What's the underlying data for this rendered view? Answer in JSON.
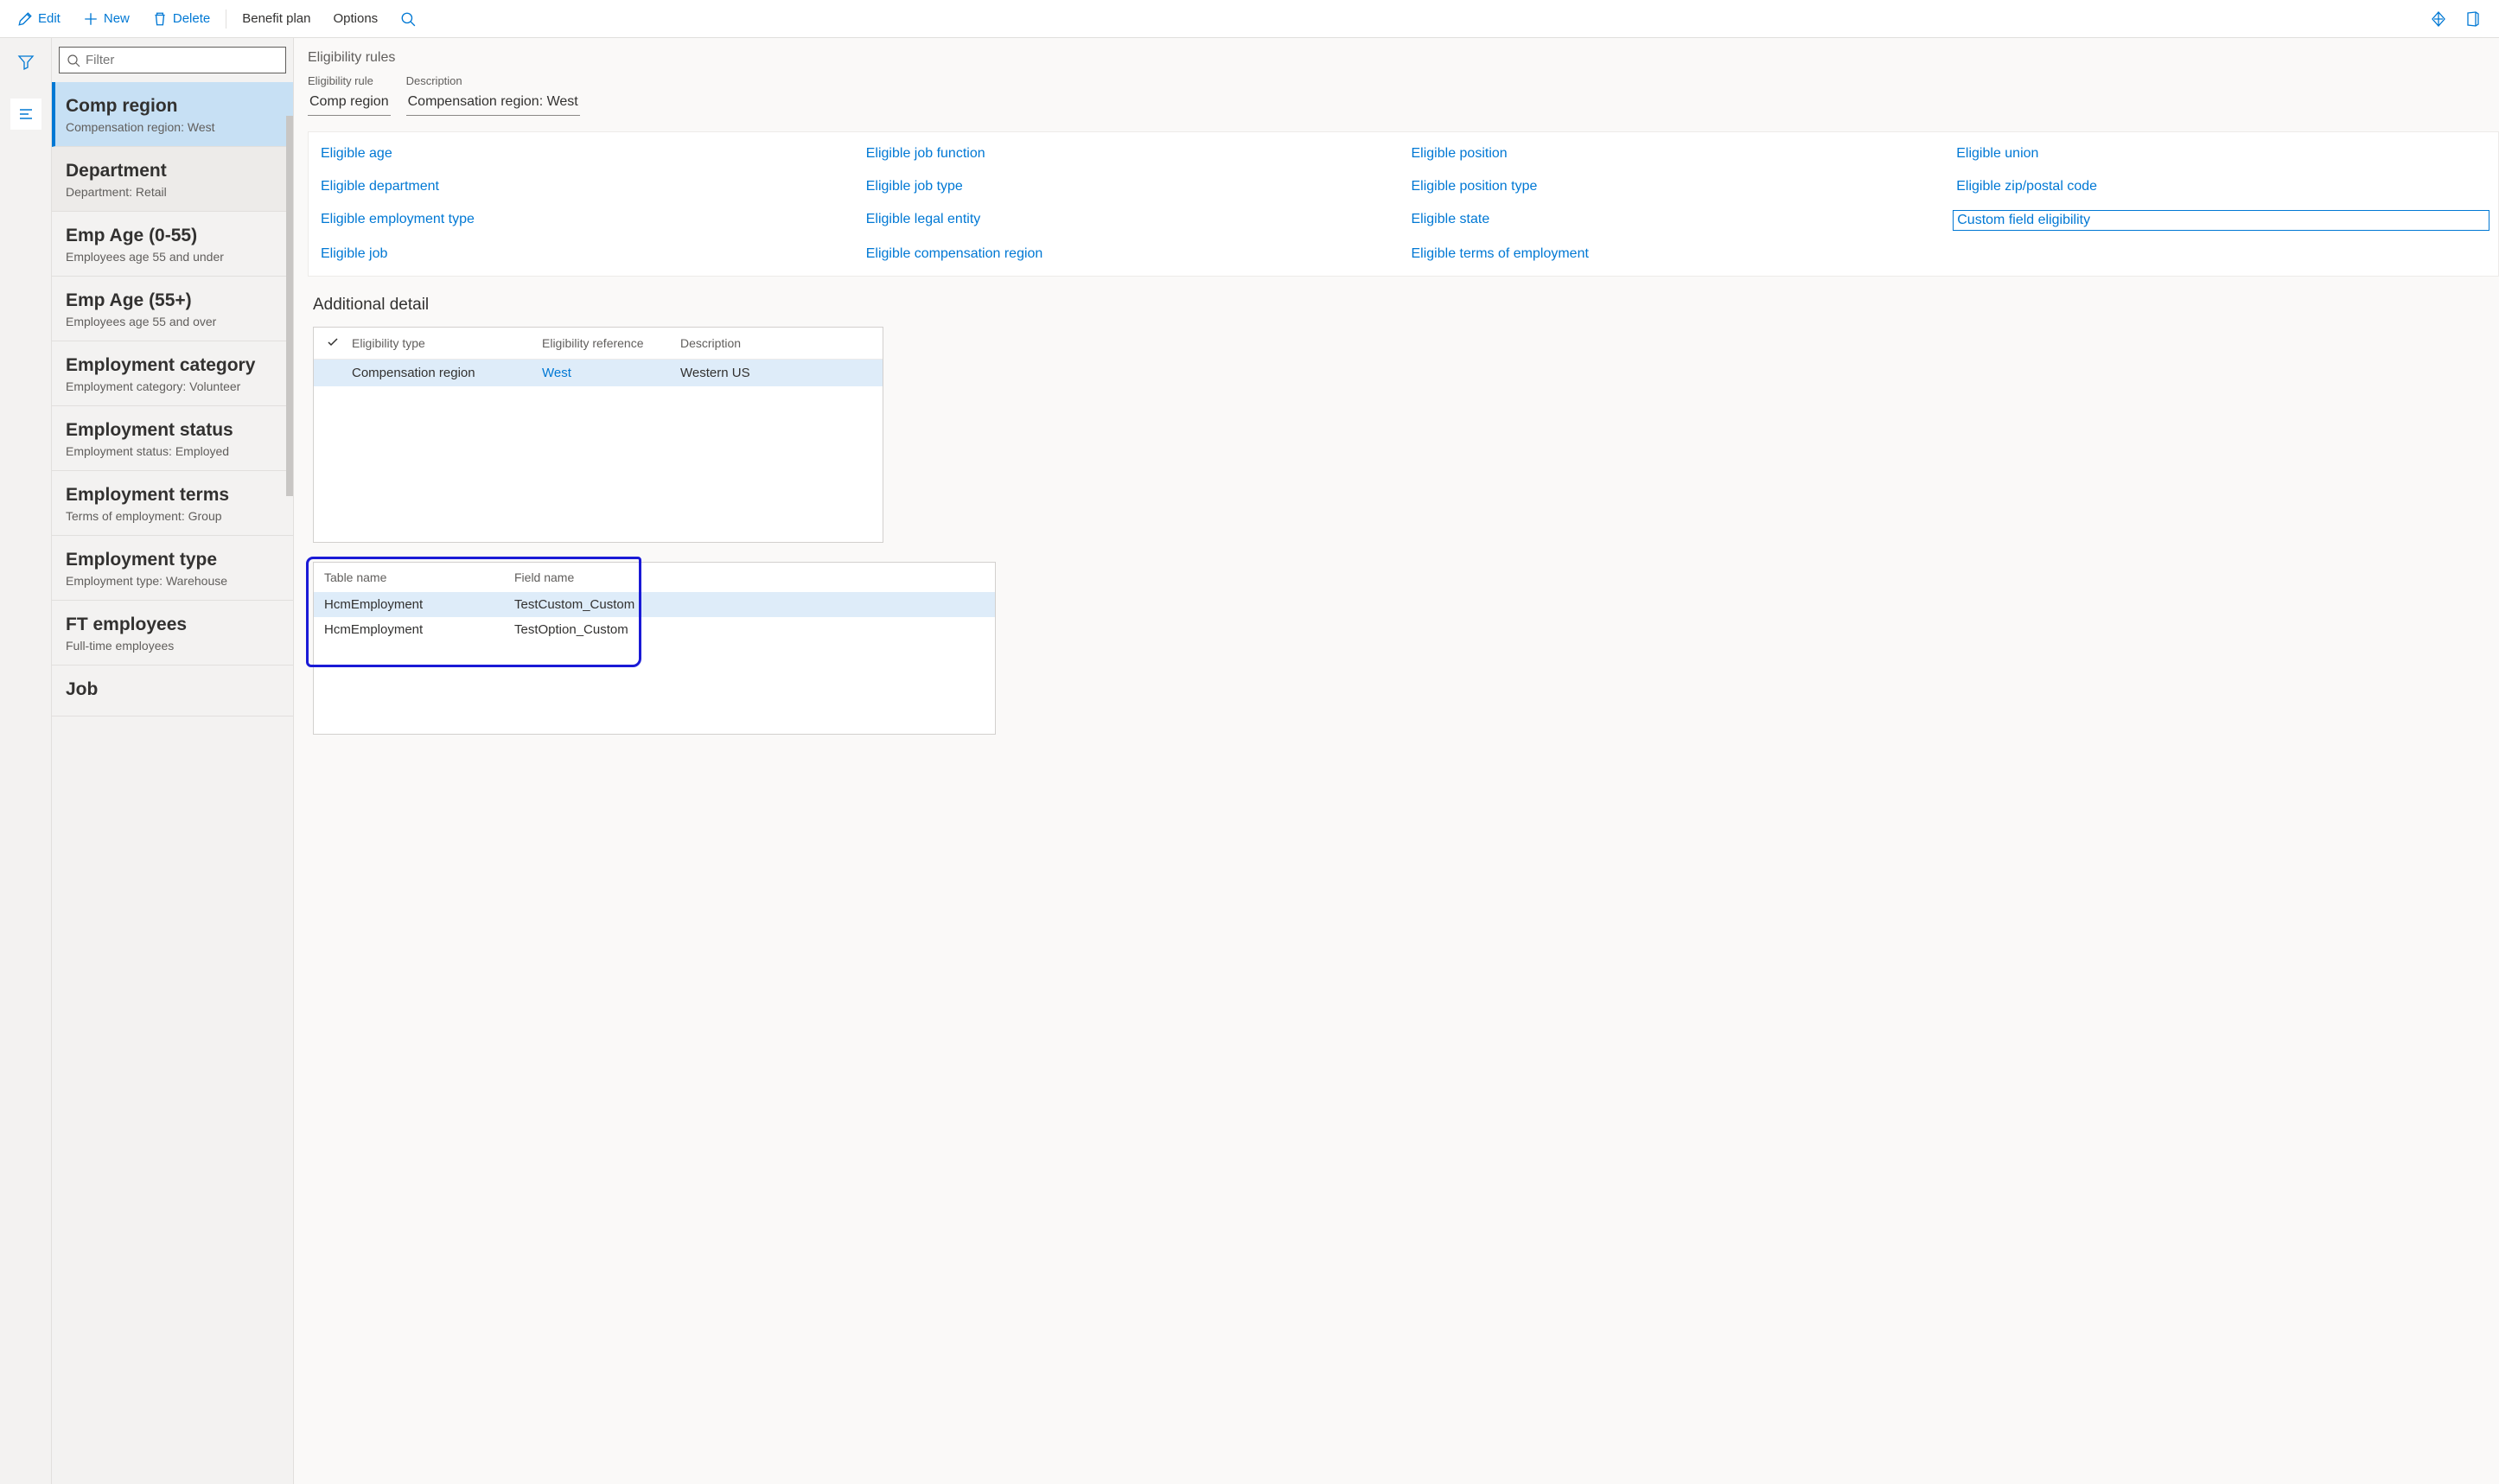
{
  "toolbar": {
    "edit": "Edit",
    "new": "New",
    "delete": "Delete",
    "benefit_plan": "Benefit plan",
    "options": "Options"
  },
  "filter": {
    "placeholder": "Filter"
  },
  "sidebar_items": [
    {
      "title": "Comp region",
      "desc": "Compensation region:  West"
    },
    {
      "title": "Department",
      "desc": "Department:  Retail"
    },
    {
      "title": "Emp Age (0-55)",
      "desc": "Employees age 55 and under"
    },
    {
      "title": "Emp Age (55+)",
      "desc": "Employees age 55 and over"
    },
    {
      "title": "Employment category",
      "desc": "Employment category:  Volunteer"
    },
    {
      "title": "Employment status",
      "desc": "Employment status: Employed"
    },
    {
      "title": "Employment terms",
      "desc": "Terms of employment: Group"
    },
    {
      "title": "Employment type",
      "desc": "Employment type: Warehouse"
    },
    {
      "title": "FT employees",
      "desc": "Full-time employees"
    },
    {
      "title": "Job",
      "desc": ""
    }
  ],
  "main": {
    "section_title": "Eligibility rules",
    "rule_label": "Eligibility rule",
    "rule_value": "Comp region",
    "desc_label": "Description",
    "desc_value": "Compensation region:  West",
    "links": [
      "Eligible age",
      "Eligible job function",
      "Eligible position",
      "Eligible union",
      "Eligible department",
      "Eligible job type",
      "Eligible position type",
      "Eligible zip/postal code",
      "Eligible employment type",
      "Eligible legal entity",
      "Eligible state",
      "Custom field eligibility",
      "Eligible job",
      "Eligible compensation region",
      "Eligible terms of employment"
    ],
    "additional_detail": "Additional detail",
    "grid1": {
      "cols": [
        "",
        "Eligibility type",
        "Eligibility reference",
        "Description"
      ],
      "rows": [
        {
          "type": "Compensation region",
          "ref": "West",
          "desc": "Western US"
        }
      ]
    },
    "grid2": {
      "cols": [
        "Table name",
        "Field name"
      ],
      "rows": [
        {
          "table": "HcmEmployment",
          "field": "TestCustom_Custom"
        },
        {
          "table": "HcmEmployment",
          "field": "TestOption_Custom"
        }
      ]
    }
  }
}
